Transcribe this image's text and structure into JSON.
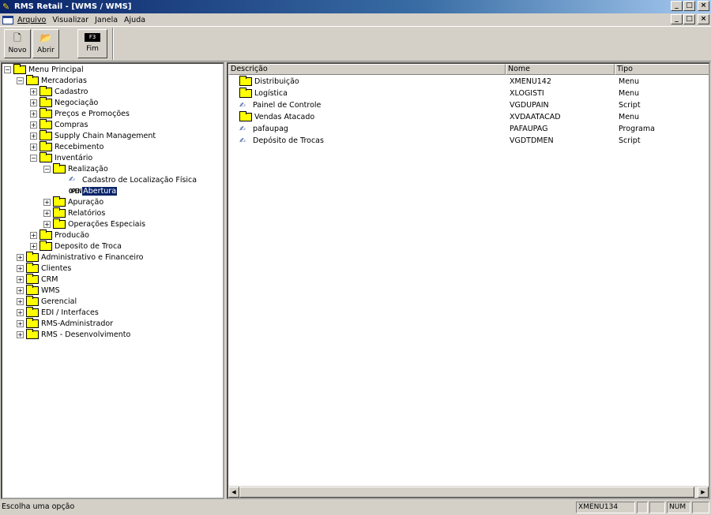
{
  "window": {
    "title": "RMS Retail - [WMS / WMS]",
    "minimize": "_",
    "restore": "□",
    "close": "×"
  },
  "menu": {
    "items": [
      "Arquivo",
      "Visualizar",
      "Janela",
      "Ajuda"
    ]
  },
  "toolbar": {
    "novo_label": "Novo",
    "abrir_label": "Abrir",
    "fim_label": "Fim",
    "fim_key": "F3"
  },
  "tree": {
    "root": "Menu Principal",
    "mercadorias": "Mercadorias",
    "cadastro": "Cadastro",
    "negociacao": "Negociação",
    "precos": "Preços e Promoções",
    "compras": "Compras",
    "scm": "Supply Chain Management",
    "recebimento": "Recebimento",
    "inventario": "Inventário",
    "realizacao": "Realização",
    "cadastro_local": "Cadastro de Localização Física",
    "open_tag": "OPEN",
    "abertura": "Abertura",
    "apuracao": "Apuração",
    "relatorios": "Relatórios",
    "operacoes": "Operações Especiais",
    "producao": "Producão",
    "deposito_troca": "Deposito de Troca",
    "admin_fin": "Administrativo e Financeiro",
    "clientes": "Clientes",
    "crm": "CRM",
    "wms": "WMS",
    "gerencial": "Gerencial",
    "edi": "EDI / Interfaces",
    "rms_admin": "RMS-Administrador",
    "rms_dev": "RMS - Desenvolvimento"
  },
  "list": {
    "headers": [
      "Descrição",
      "Nome",
      "Tipo"
    ],
    "rows": [
      {
        "icon": "folder-icon",
        "desc": "Distribuição",
        "nome": "XMENU142",
        "tipo": "Menu"
      },
      {
        "icon": "folder-icon",
        "desc": "Logística",
        "nome": "XLOGISTI",
        "tipo": "Menu"
      },
      {
        "icon": "script-icon",
        "desc": "Painel de Controle",
        "nome": "VGDUPAIN",
        "tipo": "Script"
      },
      {
        "icon": "folder-icon",
        "desc": "Vendas Atacado",
        "nome": "XVDAATACAD",
        "tipo": "Menu"
      },
      {
        "icon": "script-icon",
        "desc": "pafaupag",
        "nome": "PAFAUPAG",
        "tipo": "Programa"
      },
      {
        "icon": "script-icon",
        "desc": "Depósito de Trocas",
        "nome": "VGDTDMEN",
        "tipo": "Script"
      }
    ]
  },
  "status": {
    "message": "Escolha uma opção",
    "code": "XMENU134",
    "num": "NUM"
  }
}
